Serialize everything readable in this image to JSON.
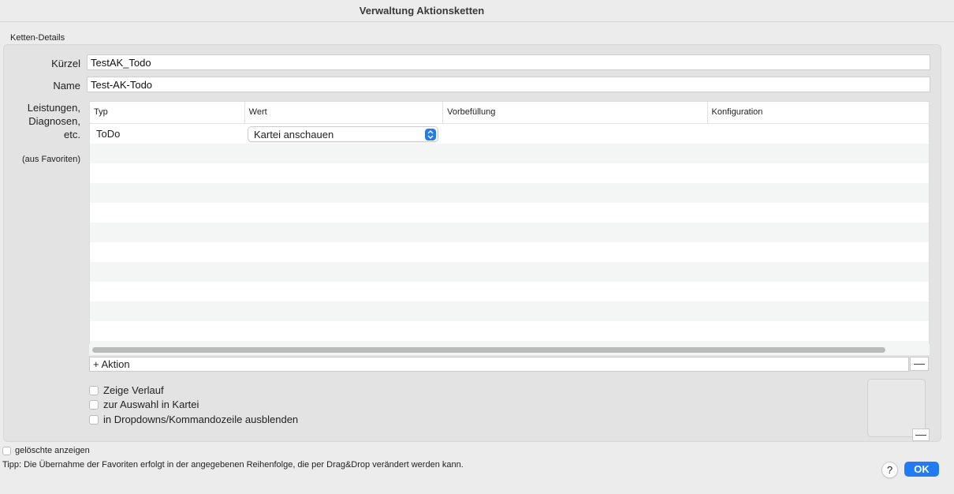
{
  "window": {
    "title": "Verwaltung Aktionsketten"
  },
  "group": {
    "label": "Ketten-Details"
  },
  "form": {
    "kuerzel_label": "Kürzel",
    "kuerzel_value": "TestAK_Todo",
    "name_label": "Name",
    "name_value": "Test-AK-Todo",
    "leistungen_label_1": "Leistungen,",
    "leistungen_label_2": "Diagnosen,",
    "leistungen_label_3": "etc.",
    "favoriten_label": "(aus Favoriten)"
  },
  "table": {
    "columns": [
      "Typ",
      "Wert",
      "Vorbefüllung",
      "Konfiguration"
    ],
    "rows": [
      {
        "typ": "ToDo",
        "wert": "Kartei anschauen",
        "vorbefuellung": "",
        "konfiguration": ""
      }
    ]
  },
  "actions": {
    "add_label": "+ Aktion",
    "remove_label": "—"
  },
  "options": {
    "zeige_verlauf": "Zeige Verlauf",
    "zur_auswahl": "zur Auswahl in Kartei",
    "ausblenden": "in Dropdowns/Kommandozeile ausblenden",
    "preview_remove": "—"
  },
  "footer": {
    "geloeschte": "gelöschte anzeigen",
    "tip": "Tipp: Die Übernahme der Favoriten erfolgt in der angegebenen Reihenfolge, die per Drag&Drop verändert werden kann.",
    "help": "?",
    "ok": "OK"
  },
  "colors": {
    "accent": "#1f7cf6"
  }
}
